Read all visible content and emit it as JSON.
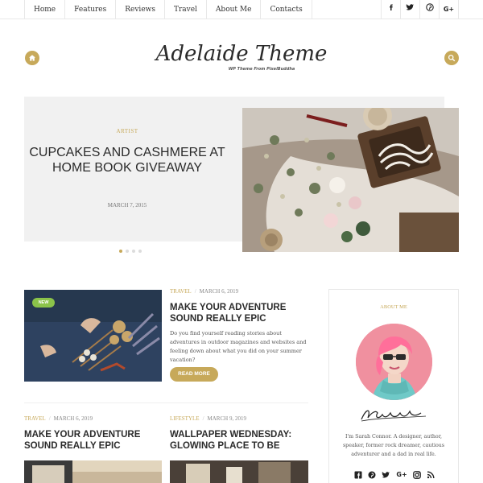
{
  "nav": {
    "items": [
      "Home",
      "Features",
      "Reviews",
      "Travel",
      "About Me",
      "Contacts"
    ],
    "social": [
      {
        "icon": "facebook-icon",
        "glyph": "f"
      },
      {
        "icon": "twitter-icon",
        "glyph": "t"
      },
      {
        "icon": "pinterest-icon",
        "glyph": "p"
      },
      {
        "icon": "google-plus-icon",
        "glyph": "G+"
      }
    ]
  },
  "header": {
    "logo": "Adelaide Theme",
    "tagline": "WP Theme From PixelBuddha",
    "home_icon": "home-icon",
    "search_icon": "search-icon"
  },
  "featured": {
    "category": "Artist",
    "title": "Cupcakes and Cashmere at Home Book Giveaway",
    "date": "March 7, 2015",
    "dots": 4,
    "active_dot": 0
  },
  "posts": [
    {
      "category": "Travel",
      "date": "March 6, 2019",
      "title": "Make Your Adventure Sound Really Epic",
      "excerpt": "Do you find yourself reading stories about adventures in outdoor magazines and websites and feeling down about what you did on your summer vacation?",
      "badge": "NEW",
      "button": "READ MORE"
    },
    {
      "category": "Travel",
      "date": "March 6, 2019",
      "title": "Make Your Adventure Sound Really Epic"
    },
    {
      "category": "Lifestyle",
      "date": "March 9, 2019",
      "title": "Wallpaper Wednesday: Glowing Place to Be"
    }
  ],
  "about": {
    "title": "About Me",
    "text": "I'm Sarah Connor. A designer, author, speaker, former rock dreamer, cautious adventurer and a dad in real life.",
    "social": [
      "facebook-icon",
      "pinterest-icon",
      "twitter-icon",
      "google-plus-icon",
      "instagram-icon",
      "rss-icon"
    ]
  },
  "colors": {
    "accent": "#c7a95a",
    "badge": "#8bc34a",
    "slider_bg": "#f1f1f1"
  }
}
